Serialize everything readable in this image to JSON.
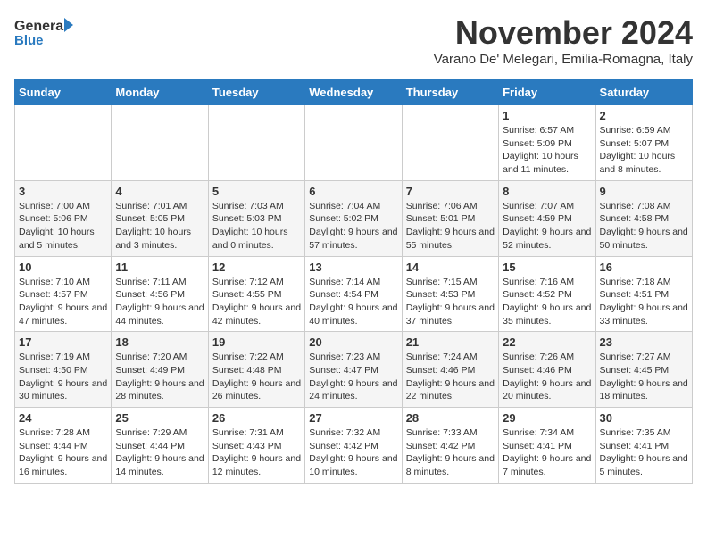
{
  "logo": {
    "general": "General",
    "blue": "Blue"
  },
  "title": "November 2024",
  "subtitle": "Varano De' Melegari, Emilia-Romagna, Italy",
  "days_header": [
    "Sunday",
    "Monday",
    "Tuesday",
    "Wednesday",
    "Thursday",
    "Friday",
    "Saturday"
  ],
  "weeks": [
    [
      {
        "day": "",
        "info": ""
      },
      {
        "day": "",
        "info": ""
      },
      {
        "day": "",
        "info": ""
      },
      {
        "day": "",
        "info": ""
      },
      {
        "day": "",
        "info": ""
      },
      {
        "day": "1",
        "info": "Sunrise: 6:57 AM\nSunset: 5:09 PM\nDaylight: 10 hours and 11 minutes."
      },
      {
        "day": "2",
        "info": "Sunrise: 6:59 AM\nSunset: 5:07 PM\nDaylight: 10 hours and 8 minutes."
      }
    ],
    [
      {
        "day": "3",
        "info": "Sunrise: 7:00 AM\nSunset: 5:06 PM\nDaylight: 10 hours and 5 minutes."
      },
      {
        "day": "4",
        "info": "Sunrise: 7:01 AM\nSunset: 5:05 PM\nDaylight: 10 hours and 3 minutes."
      },
      {
        "day": "5",
        "info": "Sunrise: 7:03 AM\nSunset: 5:03 PM\nDaylight: 10 hours and 0 minutes."
      },
      {
        "day": "6",
        "info": "Sunrise: 7:04 AM\nSunset: 5:02 PM\nDaylight: 9 hours and 57 minutes."
      },
      {
        "day": "7",
        "info": "Sunrise: 7:06 AM\nSunset: 5:01 PM\nDaylight: 9 hours and 55 minutes."
      },
      {
        "day": "8",
        "info": "Sunrise: 7:07 AM\nSunset: 4:59 PM\nDaylight: 9 hours and 52 minutes."
      },
      {
        "day": "9",
        "info": "Sunrise: 7:08 AM\nSunset: 4:58 PM\nDaylight: 9 hours and 50 minutes."
      }
    ],
    [
      {
        "day": "10",
        "info": "Sunrise: 7:10 AM\nSunset: 4:57 PM\nDaylight: 9 hours and 47 minutes."
      },
      {
        "day": "11",
        "info": "Sunrise: 7:11 AM\nSunset: 4:56 PM\nDaylight: 9 hours and 44 minutes."
      },
      {
        "day": "12",
        "info": "Sunrise: 7:12 AM\nSunset: 4:55 PM\nDaylight: 9 hours and 42 minutes."
      },
      {
        "day": "13",
        "info": "Sunrise: 7:14 AM\nSunset: 4:54 PM\nDaylight: 9 hours and 40 minutes."
      },
      {
        "day": "14",
        "info": "Sunrise: 7:15 AM\nSunset: 4:53 PM\nDaylight: 9 hours and 37 minutes."
      },
      {
        "day": "15",
        "info": "Sunrise: 7:16 AM\nSunset: 4:52 PM\nDaylight: 9 hours and 35 minutes."
      },
      {
        "day": "16",
        "info": "Sunrise: 7:18 AM\nSunset: 4:51 PM\nDaylight: 9 hours and 33 minutes."
      }
    ],
    [
      {
        "day": "17",
        "info": "Sunrise: 7:19 AM\nSunset: 4:50 PM\nDaylight: 9 hours and 30 minutes."
      },
      {
        "day": "18",
        "info": "Sunrise: 7:20 AM\nSunset: 4:49 PM\nDaylight: 9 hours and 28 minutes."
      },
      {
        "day": "19",
        "info": "Sunrise: 7:22 AM\nSunset: 4:48 PM\nDaylight: 9 hours and 26 minutes."
      },
      {
        "day": "20",
        "info": "Sunrise: 7:23 AM\nSunset: 4:47 PM\nDaylight: 9 hours and 24 minutes."
      },
      {
        "day": "21",
        "info": "Sunrise: 7:24 AM\nSunset: 4:46 PM\nDaylight: 9 hours and 22 minutes."
      },
      {
        "day": "22",
        "info": "Sunrise: 7:26 AM\nSunset: 4:46 PM\nDaylight: 9 hours and 20 minutes."
      },
      {
        "day": "23",
        "info": "Sunrise: 7:27 AM\nSunset: 4:45 PM\nDaylight: 9 hours and 18 minutes."
      }
    ],
    [
      {
        "day": "24",
        "info": "Sunrise: 7:28 AM\nSunset: 4:44 PM\nDaylight: 9 hours and 16 minutes."
      },
      {
        "day": "25",
        "info": "Sunrise: 7:29 AM\nSunset: 4:44 PM\nDaylight: 9 hours and 14 minutes."
      },
      {
        "day": "26",
        "info": "Sunrise: 7:31 AM\nSunset: 4:43 PM\nDaylight: 9 hours and 12 minutes."
      },
      {
        "day": "27",
        "info": "Sunrise: 7:32 AM\nSunset: 4:42 PM\nDaylight: 9 hours and 10 minutes."
      },
      {
        "day": "28",
        "info": "Sunrise: 7:33 AM\nSunset: 4:42 PM\nDaylight: 9 hours and 8 minutes."
      },
      {
        "day": "29",
        "info": "Sunrise: 7:34 AM\nSunset: 4:41 PM\nDaylight: 9 hours and 7 minutes."
      },
      {
        "day": "30",
        "info": "Sunrise: 7:35 AM\nSunset: 4:41 PM\nDaylight: 9 hours and 5 minutes."
      }
    ]
  ]
}
